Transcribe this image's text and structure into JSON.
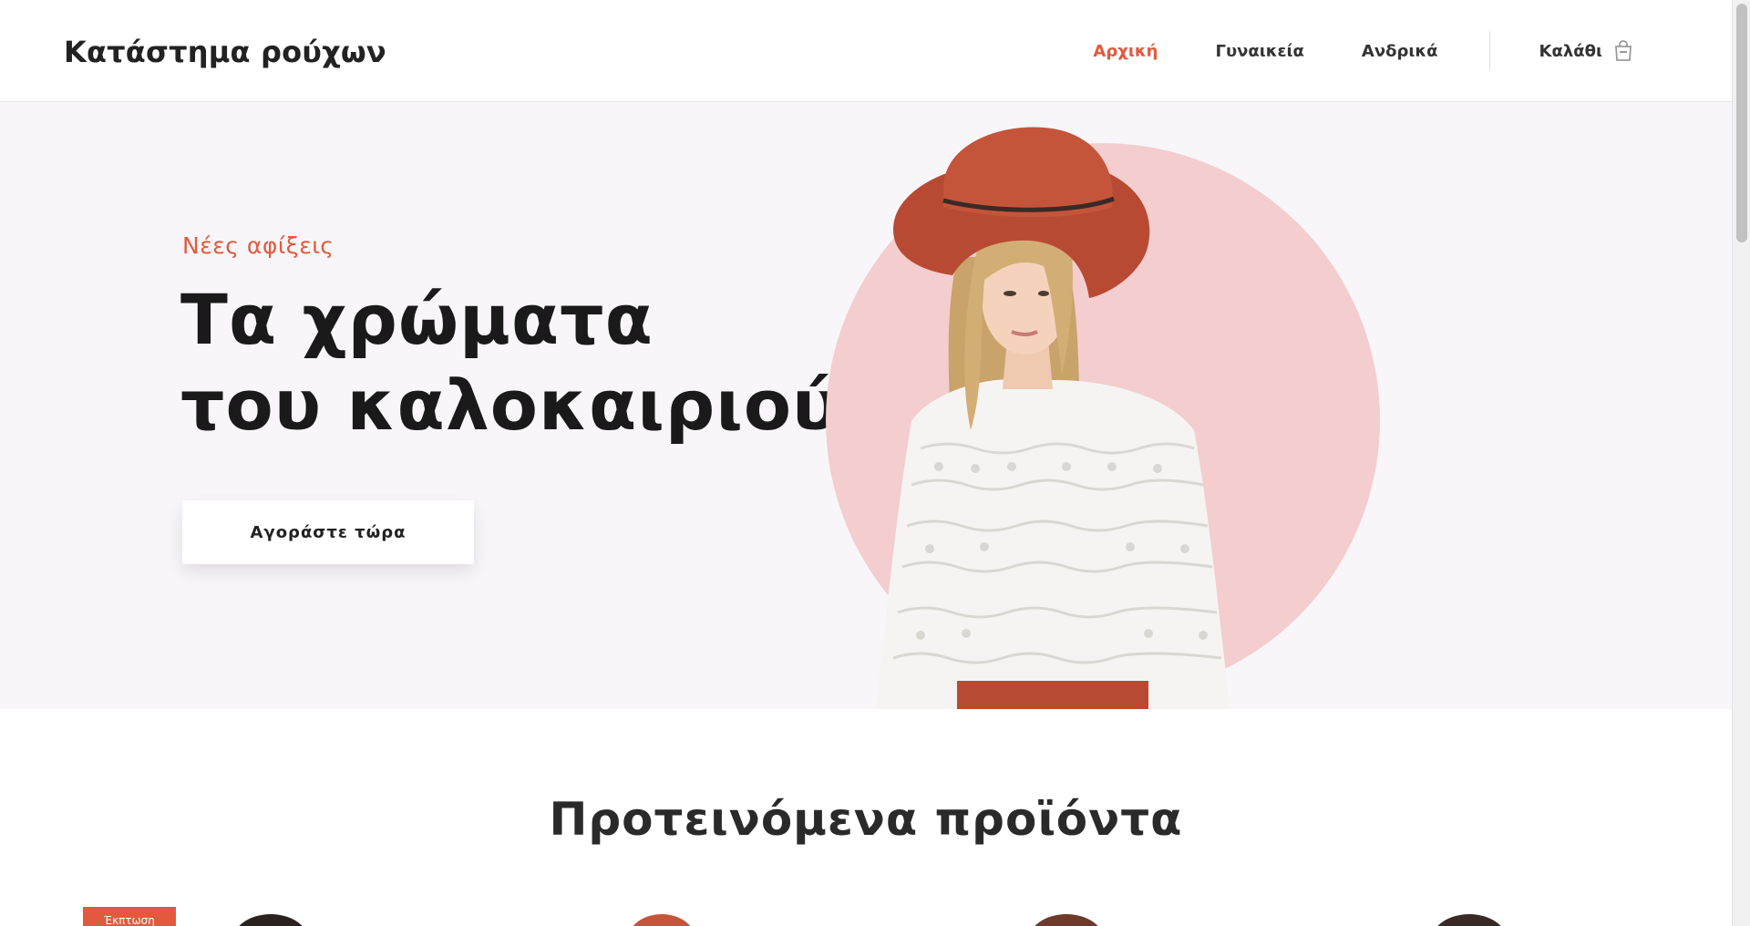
{
  "header": {
    "logo": "Κατάστημα ρούχων",
    "nav": [
      {
        "label": "Αρχική",
        "active": true
      },
      {
        "label": "Γυναικεία",
        "active": false
      },
      {
        "label": "Ανδρικά",
        "active": false
      }
    ],
    "cart_label": "Καλάθι",
    "cart_icon": "shopping-bag-icon"
  },
  "hero": {
    "eyebrow": "Νέες αφίξεις",
    "title_line1": "Τα χρώματα",
    "title_line2": "του καλοκαιριού",
    "cta_label": "Αγοράστε τώρα"
  },
  "featured": {
    "title": "Προτεινόμενα προϊόντα",
    "badge": "Έκπτωση"
  },
  "colors": {
    "accent": "#e25a3d",
    "hero_bg": "#f8f6f9",
    "circle": "#f4cdcf"
  }
}
